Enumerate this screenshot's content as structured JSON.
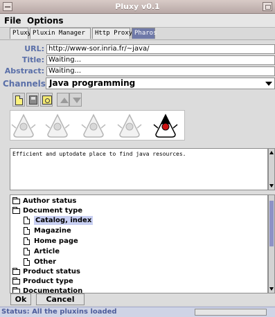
{
  "window": {
    "title": "Pluxy v0.1"
  },
  "menus": [
    "File",
    "Options"
  ],
  "tabs": [
    "Pluxy",
    "Pluxin Manager",
    "Http Proxy",
    "Pharos"
  ],
  "active_tab": "Pharos",
  "fields": {
    "url_label": "URL:",
    "url_value": "http://www-sor.inria.fr/~java/",
    "title_label": "Title:",
    "title_value": "Waiting...",
    "abstract_label": "Abstract:",
    "abstract_value": "Waiting..."
  },
  "channels": {
    "label": "Channels:",
    "selected": "Java programming"
  },
  "toolbar": [
    "new-document-icon",
    "save-icon",
    "open-icon",
    "move-up-icon",
    "move-down-icon"
  ],
  "rating": {
    "value": 5,
    "max": 5
  },
  "description": "Efficient and uptodate place to find java resources.",
  "tree": {
    "items": [
      {
        "label": "Author status",
        "icon": "folder-icon",
        "level": 0
      },
      {
        "label": "Document type",
        "icon": "folder-icon",
        "level": 0
      },
      {
        "label": "Catalog, index",
        "icon": "page-icon",
        "level": 1,
        "selected": true
      },
      {
        "label": "Magazine",
        "icon": "page-icon",
        "level": 1
      },
      {
        "label": "Home page",
        "icon": "page-icon",
        "level": 1
      },
      {
        "label": "Article",
        "icon": "page-icon",
        "level": 1
      },
      {
        "label": "Other",
        "icon": "page-icon",
        "level": 1
      },
      {
        "label": "Product status",
        "icon": "folder-icon",
        "level": 0
      },
      {
        "label": "Product type",
        "icon": "folder-icon",
        "level": 0
      },
      {
        "label": "Documentation",
        "icon": "folder-icon",
        "level": 0
      }
    ]
  },
  "buttons": {
    "ok": "Ok",
    "cancel": "Cancel"
  },
  "status": {
    "text": "Status: All the pluxins loaded"
  },
  "colors": {
    "accent": "#5a6fa8",
    "active_tab": "#6f79a8",
    "selection": "#c8cff2",
    "status_bg": "#cfd4e6"
  }
}
